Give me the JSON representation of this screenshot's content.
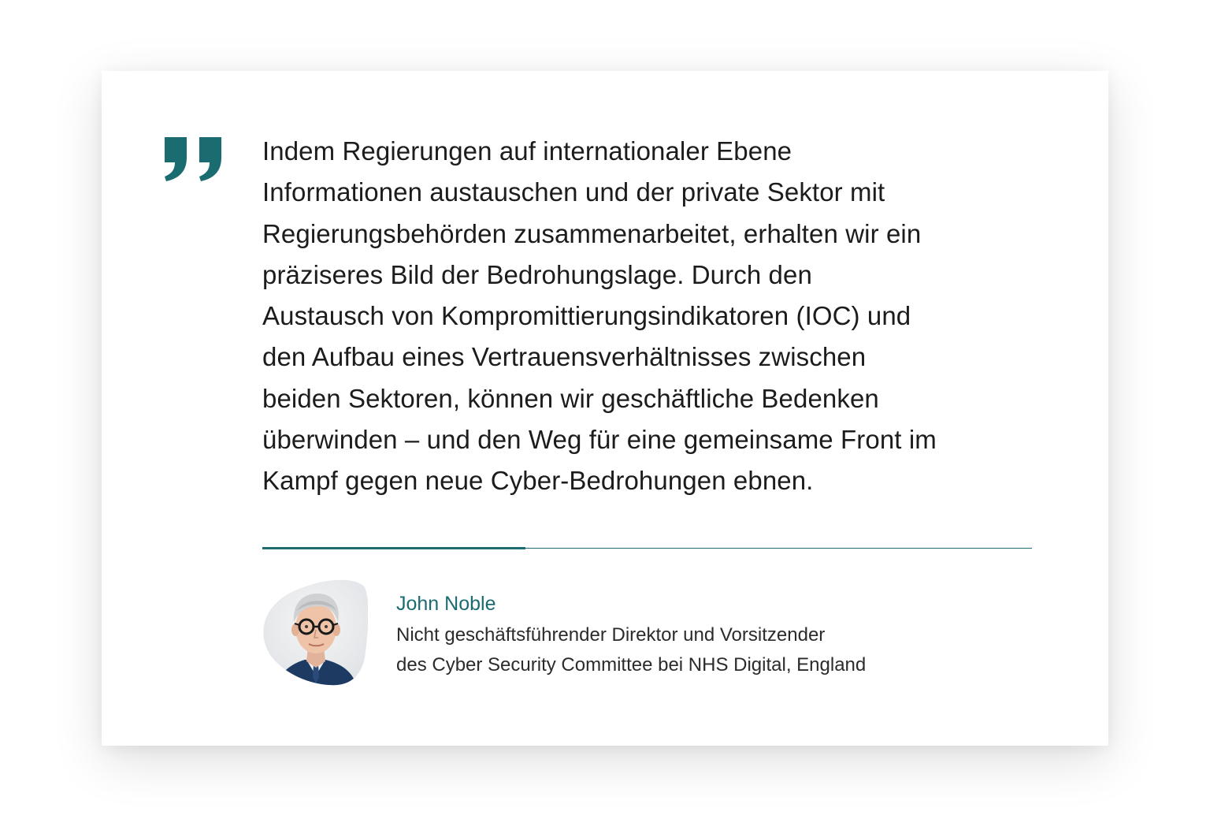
{
  "quote": {
    "lines": [
      "Indem Regierungen auf internationaler Ebene",
      "Informationen austauschen und der private Sektor mit",
      "Regierungsbehörden zusammenarbeitet, erhalten wir ein",
      "präziseres Bild der Bedrohungslage. Durch den",
      "Austausch von Kompromittierungsindikatoren (IOC) und",
      "den Aufbau eines Vertrauensverhältnisses zwischen",
      "beiden Sektoren, können wir geschäftliche Bedenken",
      "überwinden – und den Weg für eine gemeinsame Front im",
      "Kampf gegen neue Cyber-Bedrohungen ebnen."
    ],
    "mark_icon": "closing-quotation-mark-icon"
  },
  "author": {
    "name": "John Noble",
    "role_lines": [
      "Nicht geschäftsführender Direktor und Vorsitzender",
      "des Cyber Security Committee bei NHS Digital, England"
    ],
    "avatar_icon": "portrait-photo"
  },
  "colors": {
    "accent": "#1b6c71",
    "text": "#1c1c1c",
    "background": "#ffffff"
  }
}
